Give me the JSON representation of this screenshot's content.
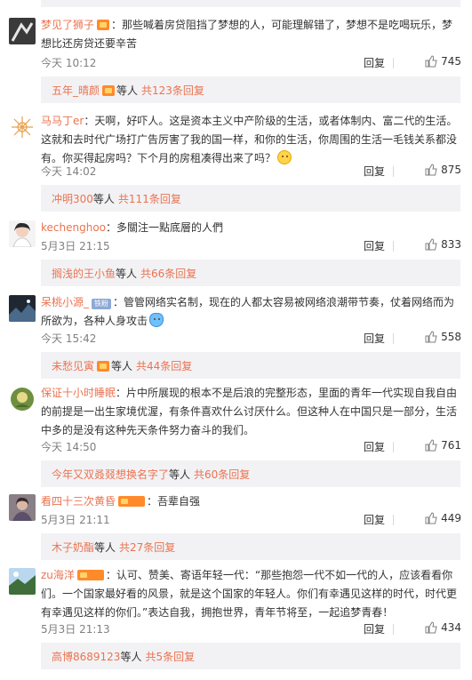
{
  "colors": {
    "user": "#eb7350",
    "sub_bg": "#f2f2f5",
    "text": "#333333",
    "meta": "#808080"
  },
  "comments": [
    {
      "user": "梦见了狮子",
      "badge": "vip",
      "text": "那些喊着房贷阻挡了梦想的人，可能理解错了，梦想不是吃喝玩乐，梦想比还房贷还要辛苦",
      "time": "今天 10:12",
      "reply_label": "回复",
      "likes": "745",
      "avatar_icon": "dark-pattern-avatar",
      "sub": {
        "user": "五年_晴颜",
        "mid": "等人",
        "total": "共123条回复",
        "badge": "vip"
      }
    },
    {
      "user": "马马丁er",
      "badge": "",
      "text": "天啊，好吓人。这是资本主义中产阶级的生活，或者体制内、富二代的生活。这就和去时代广场打广告厉害了我的国一样，和你的生活，你周围的生活一毛钱关系都没有。你买得起房吗？下个月的房租凑得出来了吗？",
      "emoji": "think-emoji",
      "time": "今天 14:02",
      "reply_label": "回复",
      "likes": "875",
      "avatar_icon": "orange-sketch-avatar",
      "sub": {
        "user": "冲明300",
        "mid": "等人",
        "total": "共111条回复",
        "badge": ""
      }
    },
    {
      "user": "kechenghoo",
      "badge": "",
      "text": "多關注一點底層的人們",
      "time": "5月3日 21:15",
      "reply_label": "回复",
      "likes": "833",
      "avatar_icon": "girl-avatar",
      "sub": {
        "user": "搁浅的王小鱼",
        "mid": "等人",
        "total": "共66条回复",
        "badge": ""
      }
    },
    {
      "user": "呆桃小源_",
      "badge": "gray",
      "badge_text": "铁粉",
      "text": "管管网络实名制，现在的人都太容易被网络浪潮带节奏，仗着网络而为所欲为，各种人身攻击",
      "emoji": "run-emoji",
      "time": "今天 15:42",
      "reply_label": "回复",
      "likes": "558",
      "avatar_icon": "night-avatar",
      "sub": {
        "user": "未愁见寅",
        "mid": "等人",
        "total": "共44条回复",
        "badge": "vip"
      }
    },
    {
      "user": "保证十小时睡眠",
      "badge": "",
      "text": "片中所展现的根本不是后浪的完整形态，里面的青年一代实现自我自由的前提是一出生家境优渥，有条件喜欢什么讨厌什么。但这种人在中国只是一部分，生活中多的是没有这种先天条件努力奋斗的我们。",
      "time": "今天 14:50",
      "reply_label": "回复",
      "likes": "761",
      "avatar_icon": "green-circle-avatar",
      "sub": {
        "user": "今年又双叒叕想换名字了",
        "mid": "等人",
        "total": "共60条回复",
        "badge": ""
      }
    },
    {
      "user": "看四十三次黄昏",
      "badge": "wide",
      "text": "吾辈自强",
      "time": "5月3日 21:11",
      "reply_label": "回复",
      "likes": "449",
      "avatar_icon": "portrait-avatar",
      "sub": {
        "user": "木子奶酯",
        "mid": "等人",
        "total": "共27条回复",
        "badge": ""
      }
    },
    {
      "user": "zu海洋",
      "badge": "wide",
      "text": "认可、赞美、寄语年轻一代：“那些抱怨一代不如一代的人，应该看看你们。一个国家最好看的风景，就是这个国家的年轻人。你们有幸遇见这样的时代，时代更有幸遇见这样的你们。”表达自我，拥抱世界，青年节将至，一起追梦青春！",
      "time": "5月3日 21:13",
      "reply_label": "回复",
      "likes": "434",
      "avatar_icon": "blue-sky-avatar",
      "sub": {
        "user": "高博8689123",
        "mid": "等人",
        "total": "共5条回复",
        "badge": ""
      }
    }
  ]
}
